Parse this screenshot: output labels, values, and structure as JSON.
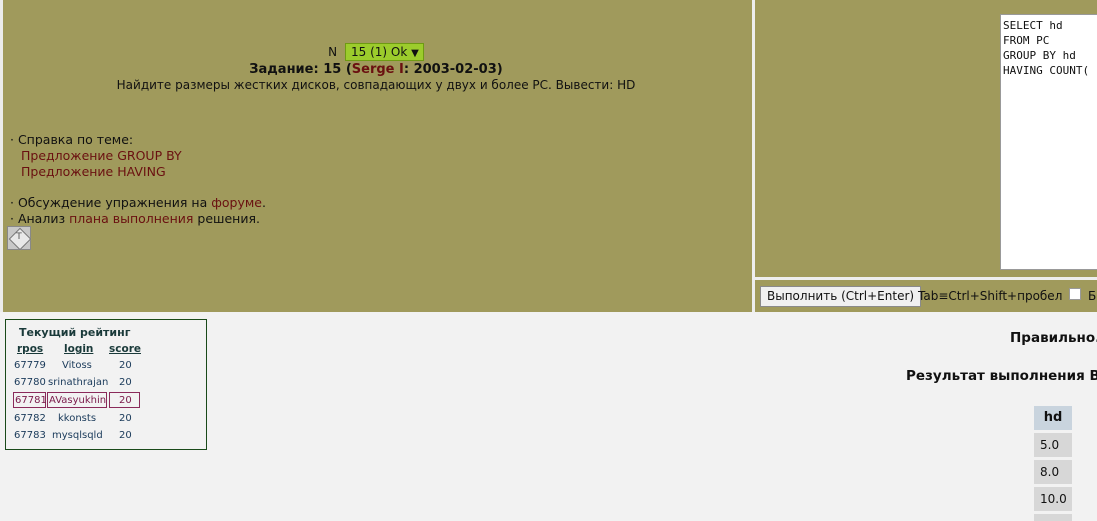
{
  "task": {
    "prefix": "N",
    "selected": "15 (1) Ok",
    "selected_arrow": "▼",
    "title_prefix": "Задание: 15 (",
    "author": "Serge I",
    "title_suffix": ": 2003-02-03)",
    "description": "Найдите размеры жестких дисков, совпадающих у двух и более PC. Вывести: HD"
  },
  "help": {
    "heading": "· Справка по теме:",
    "links": [
      "Предложение GROUP BY",
      "Предложение HAVING"
    ],
    "forum_prefix": "· Обсуждение упражнения на ",
    "forum_link": "форуме",
    "forum_suffix": ".",
    "plan_prefix": "· Анализ ",
    "plan_link": "плана выполнения",
    "plan_suffix": " решения.",
    "hint_icon_label": "T"
  },
  "editor": {
    "sql": "SELECT hd\nFROM PC\nGROUP BY hd\nHAVING COUNT("
  },
  "toolbar": {
    "run_label": "Выполнить (Ctrl+Enter)",
    "tab_hint": "Tab≡Ctrl+Shift+пробел",
    "check_label": "Б"
  },
  "rating": {
    "title": "Текущий рейтинг",
    "columns": [
      "rpos",
      "login",
      "score"
    ],
    "rows": [
      {
        "rpos": "67779",
        "login": "Vitoss",
        "score": "20"
      },
      {
        "rpos": "67780",
        "login": "srinathrajan",
        "score": "20"
      },
      {
        "rpos": "67781",
        "login": "AVasyukhin",
        "score": "20"
      },
      {
        "rpos": "67782",
        "login": "kkonsts",
        "score": "20"
      },
      {
        "rpos": "67783",
        "login": "mysqlsqld",
        "score": "20"
      }
    ]
  },
  "result": {
    "verdict": "Правильно.",
    "title": "Результат выполнения Ва",
    "column": "hd",
    "values": [
      "5.0",
      "8.0",
      "10.0"
    ]
  },
  "colors": {
    "panel": "#a09a5c",
    "link": "#6a1010",
    "select_ok": "#9ccc2c",
    "highlight_border": "#8a2a5a"
  }
}
